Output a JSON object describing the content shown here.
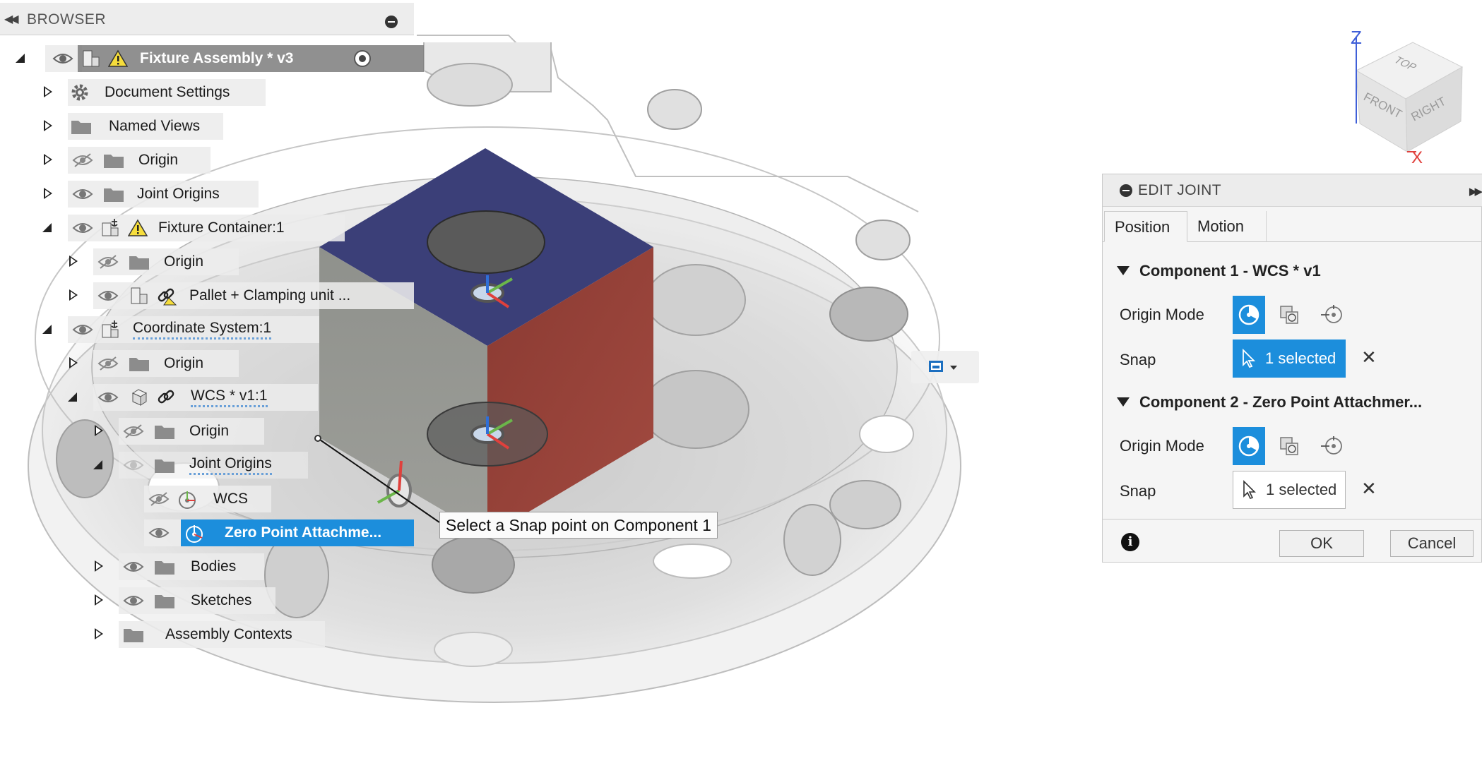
{
  "browser": {
    "title": "BROWSER",
    "items": [
      {
        "label": "Fixture Assembly * v3",
        "level": 0,
        "expanded": true
      },
      {
        "label": "Document Settings",
        "level": 1,
        "expanded": false
      },
      {
        "label": "Named Views",
        "level": 1,
        "expanded": false
      },
      {
        "label": "Origin",
        "level": 1,
        "expanded": false,
        "hidden": true
      },
      {
        "label": "Joint Origins",
        "level": 1,
        "expanded": false
      },
      {
        "label": "Fixture Container:1",
        "level": 1,
        "expanded": true
      },
      {
        "label": "Origin",
        "level": 2,
        "expanded": false,
        "hidden": true
      },
      {
        "label": "Pallet + Clamping unit ...",
        "level": 2,
        "expanded": false
      },
      {
        "label": "Coordinate System:1",
        "level": 1,
        "expanded": true
      },
      {
        "label": "Origin",
        "level": 2,
        "expanded": false,
        "hidden": true
      },
      {
        "label": "WCS * v1:1",
        "level": 2,
        "expanded": true
      },
      {
        "label": "Origin",
        "level": 3,
        "expanded": false,
        "hidden": true
      },
      {
        "label": "Joint Origins",
        "level": 3,
        "expanded": true
      },
      {
        "label": "WCS",
        "level": 4,
        "hidden": true
      },
      {
        "label": "Zero Point Attachme...",
        "level": 4,
        "selected": true
      },
      {
        "label": "Bodies",
        "level": 3,
        "expanded": false
      },
      {
        "label": "Sketches",
        "level": 3,
        "expanded": false
      },
      {
        "label": "Assembly Contexts",
        "level": 3,
        "expanded": false
      }
    ]
  },
  "edit_joint": {
    "title": "EDIT JOINT",
    "tabs": [
      "Position",
      "Motion"
    ],
    "active_tab": "Position",
    "component1": {
      "heading": "Component 1 - WCS * v1",
      "origin_mode_label": "Origin Mode",
      "snap_label": "Snap",
      "snap_value": "1 selected",
      "snap_active": true
    },
    "component2": {
      "heading": "Component 2 - Zero Point Attachmer...",
      "origin_mode_label": "Origin Mode",
      "snap_label": "Snap",
      "snap_value": "1 selected",
      "snap_active": false
    },
    "ok_label": "OK",
    "cancel_label": "Cancel",
    "info_glyph": "i",
    "clear_glyph": "✕"
  },
  "tooltip": "Select a Snap point on Component 1",
  "viewcube": {
    "axis_z": "Z",
    "axis_x": "X",
    "faces": {
      "top": "TOP",
      "front": "FRONT",
      "right": "RIGHT"
    }
  },
  "colors": {
    "accent": "#1c8edc",
    "cube_top": "#3b3f78",
    "cube_right": "#8e3a34",
    "cube_left": "#8a8c86",
    "axis_z": "#3f5fd8",
    "axis_x": "#e0403c"
  },
  "icons": {
    "browser_collapse": "double-chevron-left-icon",
    "pin": "pin-icon",
    "visibility": "eye-icon",
    "hidden": "eye-slash-icon",
    "folder": "folder-icon",
    "settings": "gear-icon",
    "warning": "warning-icon",
    "component": "component-icon",
    "link": "link-icon",
    "anchor": "anchored-component-icon",
    "joint_origin": "joint-origin-icon",
    "radio": "activate-radio-icon",
    "origin_mode": "origin-mode-icon",
    "cursor": "cursor-icon",
    "info": "info-icon",
    "display_mode": "display-mode-icon"
  }
}
